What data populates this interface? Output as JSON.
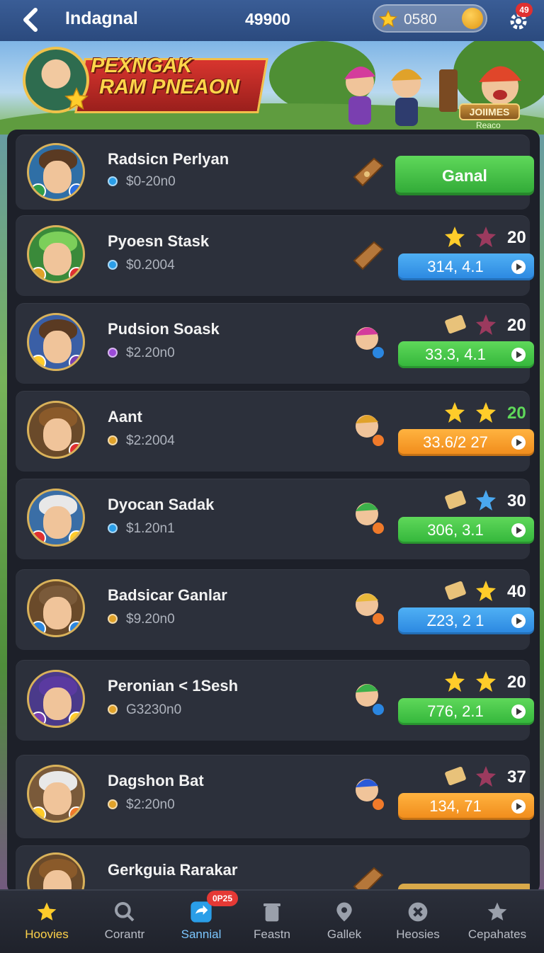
{
  "header": {
    "title": "Indagnal",
    "score": "49900",
    "coins": "0580",
    "notification_count": "49"
  },
  "banner": {
    "title_line1": "PEXNGAK",
    "title_line2": "RAM PNEAON",
    "badge": "JOIIMES",
    "badge_sub": "Reaco"
  },
  "list": {
    "rows": [
      {
        "name": "Radsicn Perlyan",
        "price": "$0-20n0",
        "action": "Ganal"
      },
      {
        "name": "Pyoesn Stask",
        "price": "$0.2004",
        "count": "20",
        "value": "314, 4.1"
      },
      {
        "name": "Pudsion Soask",
        "price": "$2.20n0",
        "count": "20",
        "value": "33.3, 4.1"
      },
      {
        "name": "Aant",
        "price": "$2:2004",
        "count": "20",
        "value": "33.6/2 27"
      },
      {
        "name": "Dyocan Sadak",
        "price": "$1.20n1",
        "count": "30",
        "value": "306, 3.1"
      },
      {
        "name": "Badsicar Ganlar",
        "price": "$9.20n0",
        "count": "40",
        "value": "Z23, 2 1"
      },
      {
        "name": "Peronian < 1Sesh",
        "price": "G3230n0",
        "count": "20",
        "value": "776, 2.1"
      },
      {
        "name": "Dagshon Bat",
        "price": "$2:20n0",
        "count": "37",
        "value": "134, 71"
      },
      {
        "name": "Gerkguia Rarakar",
        "price": ""
      }
    ]
  },
  "nav": {
    "items": [
      "Hoovies",
      "Corantr",
      "Sannial",
      "Feastn",
      "Gallek",
      "Heosies",
      "Cepahates"
    ],
    "badge": "0P25"
  },
  "colors": {
    "panel": "#1d2029",
    "row": "#2c303b",
    "green": "#3cc041",
    "blue": "#2a86e0",
    "orange": "#f08a1a",
    "gold": "#ffd34a"
  }
}
